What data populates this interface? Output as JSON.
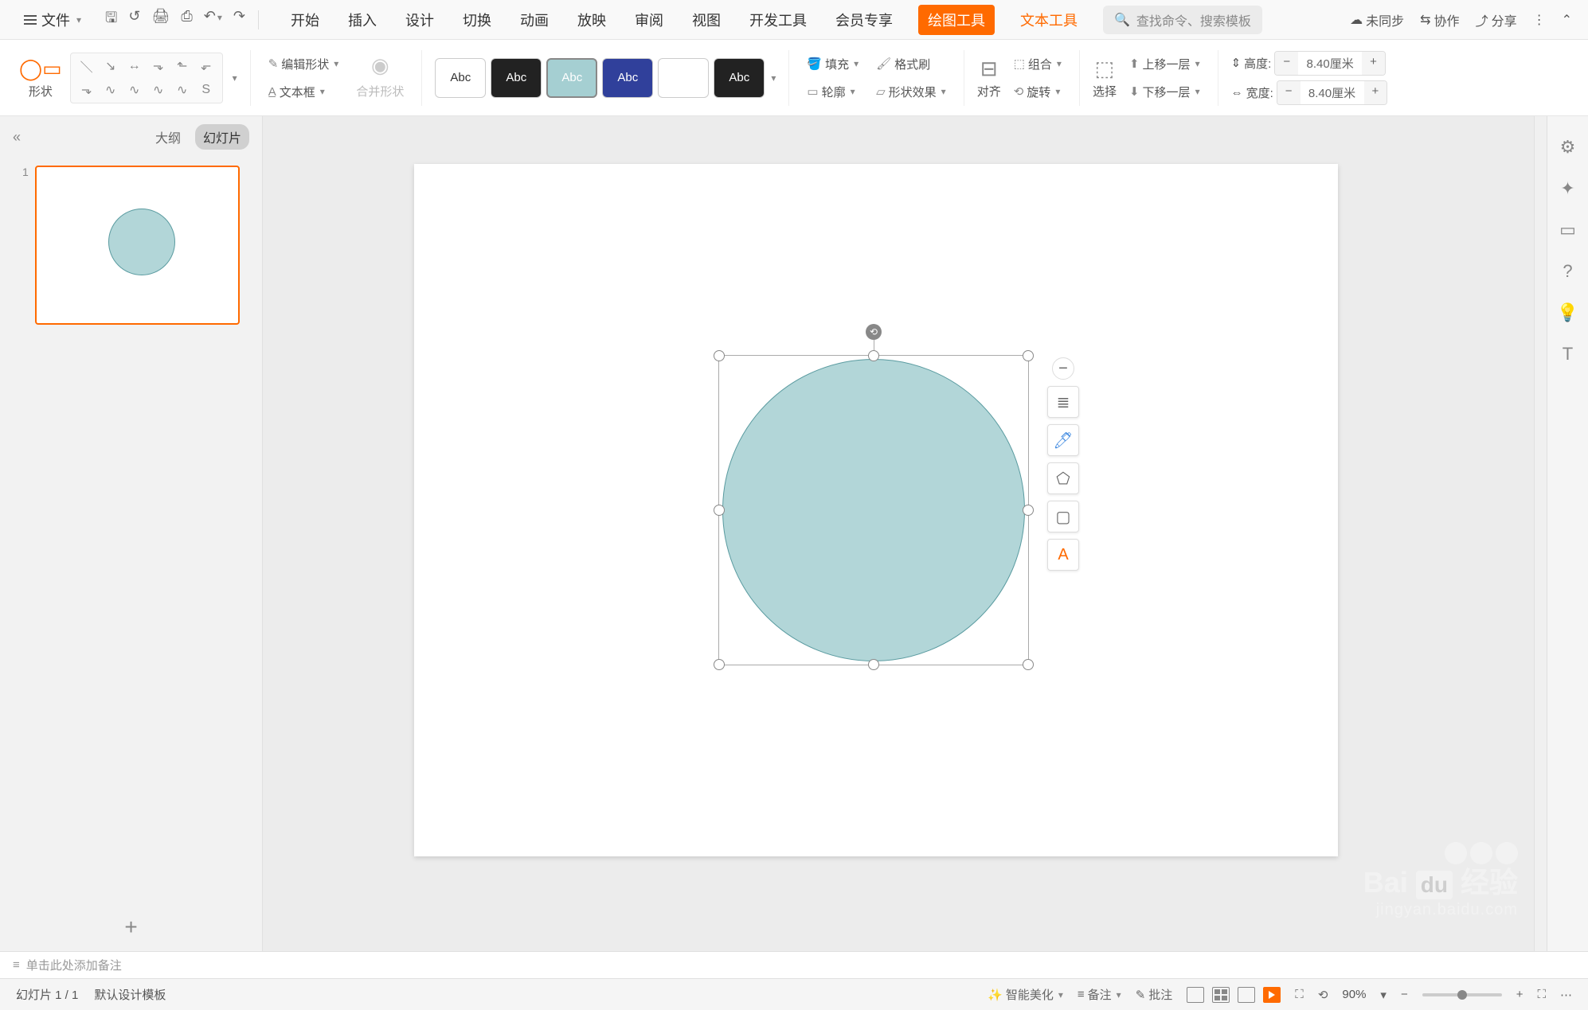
{
  "menu": {
    "file": "文件",
    "tabs": [
      "开始",
      "插入",
      "设计",
      "切换",
      "动画",
      "放映",
      "审阅",
      "视图",
      "开发工具",
      "会员专享"
    ],
    "tools": {
      "drawing": "绘图工具",
      "text": "文本工具"
    },
    "search_placeholder": "查找命令、搜索模板",
    "right": {
      "unsync": "未同步",
      "collab": "协作",
      "share": "分享"
    }
  },
  "ribbon": {
    "shape": "形状",
    "edit_shape": "编辑形状",
    "textbox": "文本框",
    "merge_shapes": "合并形状",
    "gallery_label": "Abc",
    "fill": "填充",
    "outline": "轮廓",
    "format_painter": "格式刷",
    "shape_effects": "形状效果",
    "align": "对齐",
    "group": "组合",
    "rotate": "旋转",
    "select": "选择",
    "bring_forward": "上移一层",
    "send_backward": "下移一层",
    "height_label": "高度:",
    "width_label": "宽度:",
    "height_value": "8.40厘米",
    "width_value": "8.40厘米"
  },
  "sidebar": {
    "outline_tab": "大纲",
    "slides_tab": "幻灯片",
    "slide_numbers": [
      "1"
    ]
  },
  "float_toolbar_icons": [
    "minus",
    "layers",
    "brush",
    "shape",
    "frame",
    "text-style"
  ],
  "notes": {
    "placeholder": "单击此处添加备注"
  },
  "status": {
    "slide_indicator": "幻灯片 1 / 1",
    "template": "默认设计模板",
    "beautify": "智能美化",
    "notes_btn": "备注",
    "comment_btn": "批注",
    "zoom": "90%"
  },
  "watermark": {
    "brand": "Bai",
    "brand2": "经验",
    "url": "jingyan.baidu.com"
  }
}
